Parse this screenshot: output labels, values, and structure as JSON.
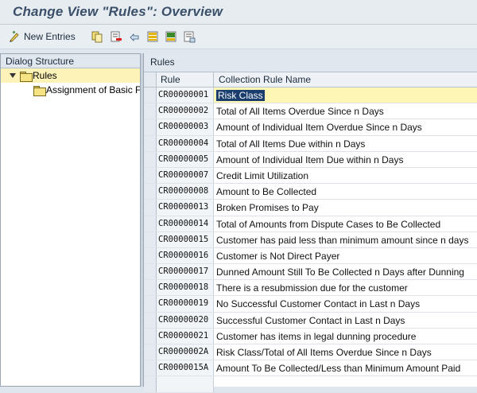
{
  "window": {
    "title": "Change View \"Rules\": Overview"
  },
  "toolbar": {
    "new_entries_label": "New Entries",
    "icons": [
      "edit-pencil-icon",
      "copy-icon",
      "delete-icon",
      "undo-icon",
      "select-all-icon",
      "select-block-icon",
      "deselect-all-icon"
    ]
  },
  "dialog_structure": {
    "header": "Dialog Structure",
    "items": [
      {
        "label": "Rules",
        "expanded": true,
        "selected": true
      },
      {
        "label": "Assignment of Basic F",
        "expanded": false,
        "selected": false
      }
    ]
  },
  "table": {
    "title": "Rules",
    "columns": [
      "Rule",
      "Collection Rule Name"
    ],
    "rows": [
      {
        "rule": "CR00000001",
        "name": "Risk Class"
      },
      {
        "rule": "CR00000002",
        "name": "Total of All Items Overdue Since n Days"
      },
      {
        "rule": "CR00000003",
        "name": "Amount of Individual Item Overdue Since n Days"
      },
      {
        "rule": "CR00000004",
        "name": "Total of All Items Due within n Days"
      },
      {
        "rule": "CR00000005",
        "name": "Amount of Individual Item Due within n Days"
      },
      {
        "rule": "CR00000007",
        "name": "Credit Limit Utilization"
      },
      {
        "rule": "CR00000008",
        "name": "Amount to Be Collected"
      },
      {
        "rule": "CR00000013",
        "name": "Broken Promises to Pay"
      },
      {
        "rule": "CR00000014",
        "name": "Total of Amounts from Dispute Cases to Be Collected"
      },
      {
        "rule": "CR00000015",
        "name": "Customer has paid less than minimum amount since n days"
      },
      {
        "rule": "CR00000016",
        "name": "Customer is Not Direct Payer"
      },
      {
        "rule": "CR00000017",
        "name": "Dunned Amount Still To Be Collected n Days after Dunning"
      },
      {
        "rule": "CR00000018",
        "name": "There is a resubmission due for the customer"
      },
      {
        "rule": "CR00000019",
        "name": "No Successful Customer Contact in Last n Days"
      },
      {
        "rule": "CR00000020",
        "name": "Successful Customer Contact in Last n Days"
      },
      {
        "rule": "CR00000021",
        "name": "Customer has items in legal dunning procedure"
      },
      {
        "rule": "CR0000002A",
        "name": "Risk Class/Total of All Items Overdue Since n Days"
      },
      {
        "rule": "CR0000015A",
        "name": "Amount To Be Collected/Less than Minimum Amount Paid"
      }
    ]
  },
  "colors": {
    "title": "#3a4f69",
    "selection": "#fdf2b7",
    "highlight": "#1a3d6e"
  }
}
